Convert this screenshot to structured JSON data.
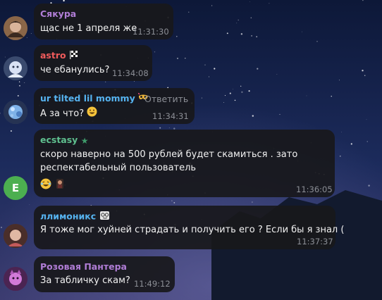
{
  "messages": [
    {
      "author": "Сякура",
      "author_color": "#b07dd6",
      "text": "щас не 1 апреля же",
      "time": "11:31:30"
    },
    {
      "author": "astro",
      "author_color": "#f05b5b",
      "text": "че ебанулись?",
      "time": "11:34:08"
    },
    {
      "author": "ur tilted lil mommy",
      "author_color": "#56b3f0",
      "reply_label": "Ответить",
      "text": "А за что?",
      "time": "11:34:31"
    },
    {
      "author": "ecstasy",
      "author_color": "#5fc08f",
      "text_line1": "скоро наверно на 500 рублей будет скамиться . зато",
      "text_line2": "респектабельный пользователь",
      "time": "11:36:05",
      "avatar_letter": "E",
      "avatar_color": "#4caf50"
    },
    {
      "author": "ллимоникс",
      "author_color": "#56b3f0",
      "text": "Я тоже мог хуйней страдать и получить его ? Если бы я знал (",
      "time": "11:37:37"
    },
    {
      "author": "Розовая Пантера",
      "author_color": "#b07dd6",
      "text": "За табличку скам?",
      "time": "11:49:12"
    }
  ]
}
